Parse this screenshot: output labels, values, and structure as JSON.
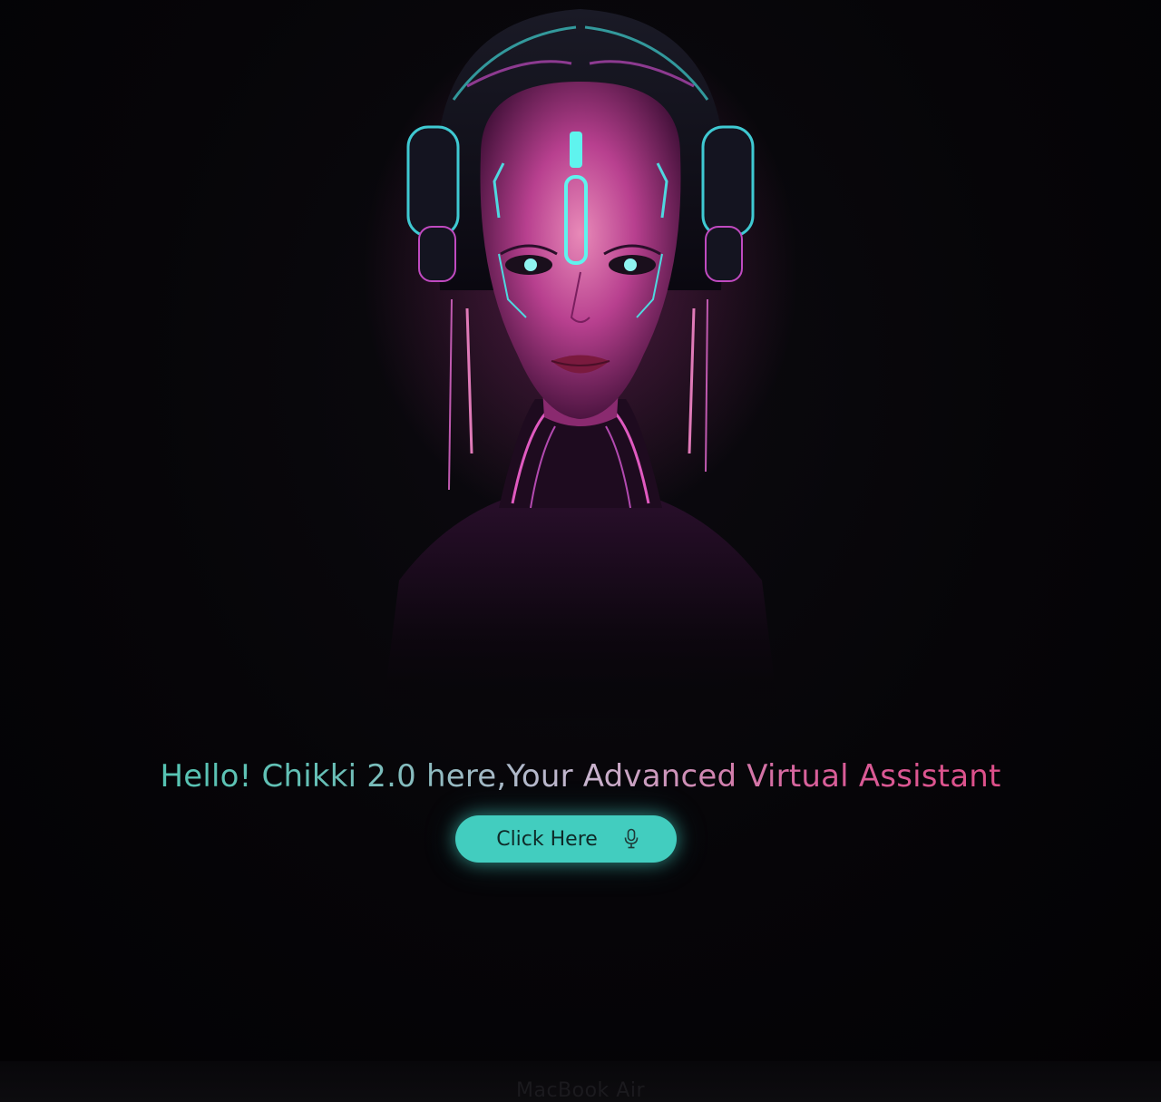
{
  "hero": {
    "greeting": "Hello! Chikki 2.0 here,Your Advanced Virtual Assistant"
  },
  "action": {
    "button_label": "Click Here",
    "button_icon": "microphone-icon"
  },
  "device": {
    "bezel_label": "MacBook Air"
  },
  "colors": {
    "background": "#040306",
    "accent_teal": "#42cdbf",
    "accent_pink": "#e2407a"
  }
}
